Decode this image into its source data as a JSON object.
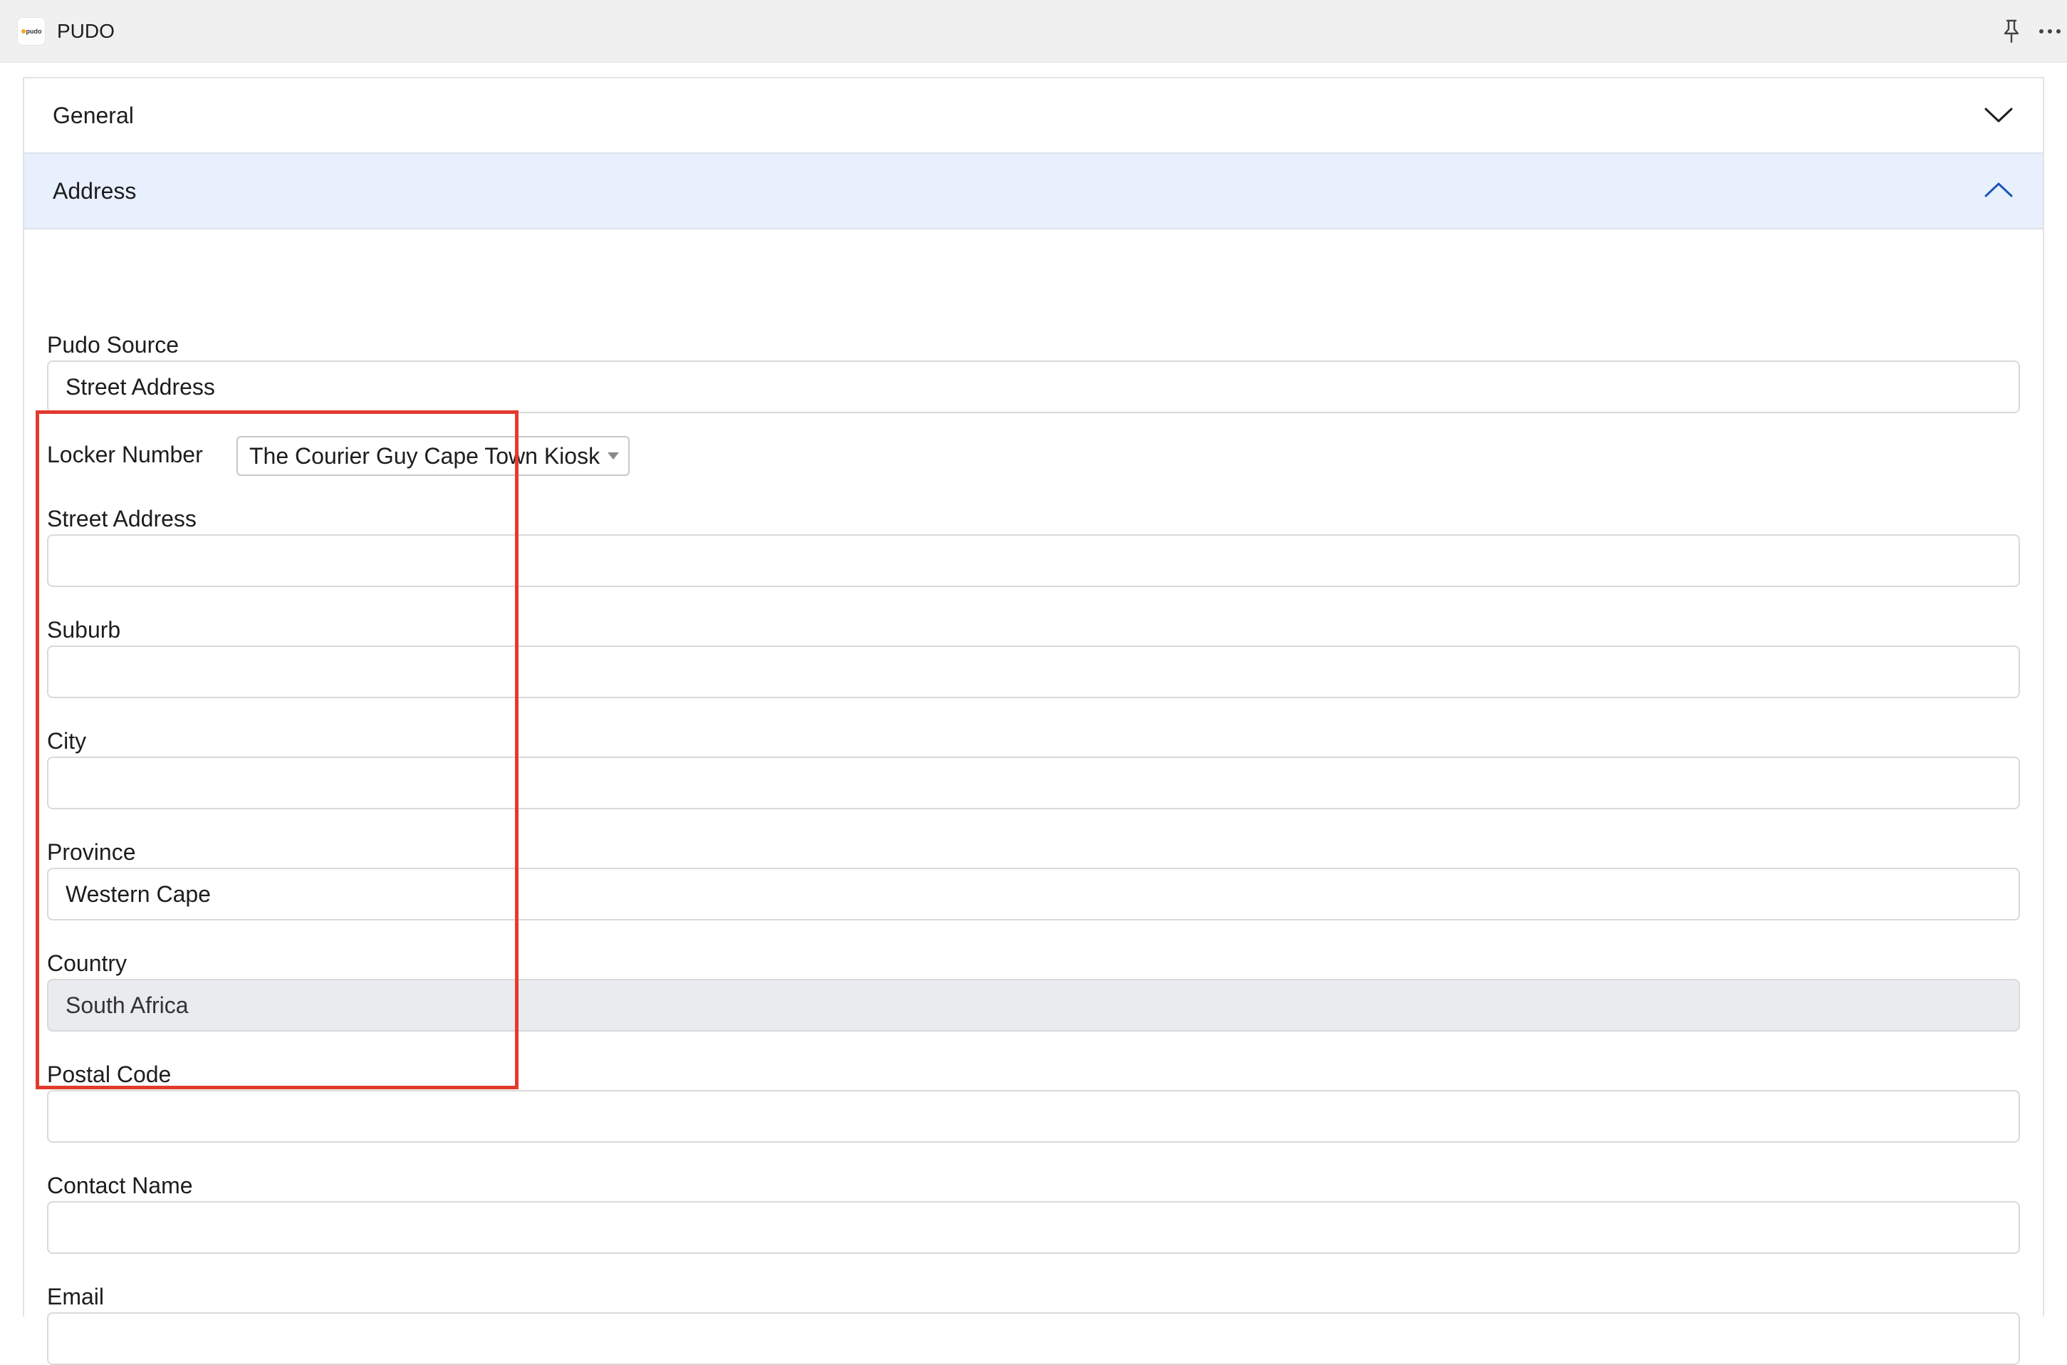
{
  "app": {
    "title": "PUDO",
    "logo_text": "pudo"
  },
  "toolbar": {
    "pin_icon": "pin-icon",
    "more_icon": "more-icon"
  },
  "accordion": {
    "general_label": "General",
    "address_label": "Address"
  },
  "form": {
    "pudo_source": {
      "label": "Pudo Source",
      "value": "Street Address"
    },
    "locker_number": {
      "label": "Locker Number",
      "selected": "The Courier Guy Cape Town Kiosk"
    },
    "street_address": {
      "label": "Street Address",
      "value": ""
    },
    "suburb": {
      "label": "Suburb",
      "value": ""
    },
    "city": {
      "label": "City",
      "value": ""
    },
    "province": {
      "label": "Province",
      "value": "Western Cape"
    },
    "country": {
      "label": "Country",
      "value": "South Africa"
    },
    "postal_code": {
      "label": "Postal Code",
      "value": ""
    },
    "contact_name": {
      "label": "Contact Name",
      "value": ""
    },
    "email": {
      "label": "Email",
      "value": ""
    }
  },
  "colors": {
    "active_header_bg": "#e8f0fd",
    "highlight": "#e23b2e",
    "disabled_input_bg": "#e9ebee"
  }
}
